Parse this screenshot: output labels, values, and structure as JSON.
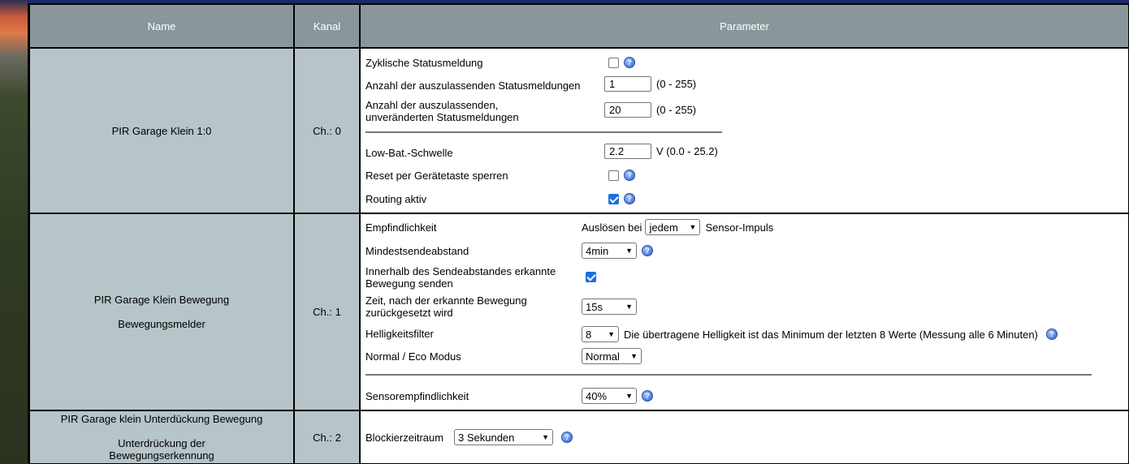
{
  "header": {
    "name": "Name",
    "kanal": "Kanal",
    "parameter": "Parameter"
  },
  "ch0": {
    "name": "PIR Garage Klein 1:0",
    "kanal": "Ch.: 0",
    "zyklisch_label": "Zyklische Statusmeldung",
    "anzahl_label": "Anzahl der auszulassenden Statusmeldungen",
    "anzahl_value": "1",
    "anzahl_range": "(0 - 255)",
    "anzahl2_label_1": "Anzahl der auszulassenden,",
    "anzahl2_label_2": "unveränderten Statusmeldungen",
    "anzahl2_value": "20",
    "anzahl2_range": "(0 - 255)",
    "lowbat_label": "Low-Bat.-Schwelle",
    "lowbat_value": "2.2",
    "lowbat_range": "V (0.0 - 25.2)",
    "reset_label": "Reset per Gerätetaste sperren",
    "routing_label": "Routing aktiv"
  },
  "ch1": {
    "name_1": "PIR Garage Klein Bewegung",
    "name_2": "Bewegungsmelder",
    "kanal": "Ch.: 1",
    "empf_label": "Empfindlichkeit",
    "empf_prefix": "Auslösen bei",
    "empf_value": "jedem",
    "empf_suffix": "Sensor-Impuls",
    "mindest_label": "Mindestsendeabstand",
    "mindest_value": "4min",
    "innerhalb_label_1": "Innerhalb des Sendeabstandes erkannte",
    "innerhalb_label_2": "Bewegung senden",
    "zeit_label_1": "Zeit, nach der erkannte Bewegung",
    "zeit_label_2": "zurückgesetzt wird",
    "zeit_value": "15s",
    "hell_label": "Helligkeitsfilter",
    "hell_value": "8",
    "hell_text": "Die übertragene Helligkeit ist das Minimum der letzten 8 Werte (Messung alle 6 Minuten)",
    "modus_label": "Normal / Eco Modus",
    "modus_value": "Normal",
    "sensor_label": "Sensorempfindlichkeit",
    "sensor_value": "40%"
  },
  "ch2": {
    "name_1": "PIR Garage klein Unterdückung Bewegung",
    "name_2": "Unterdrückung der",
    "name_3": "Bewegungserkennung",
    "kanal": "Ch.: 2",
    "block_label": "Blockierzeitraum",
    "block_value": "3 Sekunden"
  },
  "icons": {
    "help": "?",
    "checkbox_checked": "checked",
    "dropdown": "▾"
  }
}
